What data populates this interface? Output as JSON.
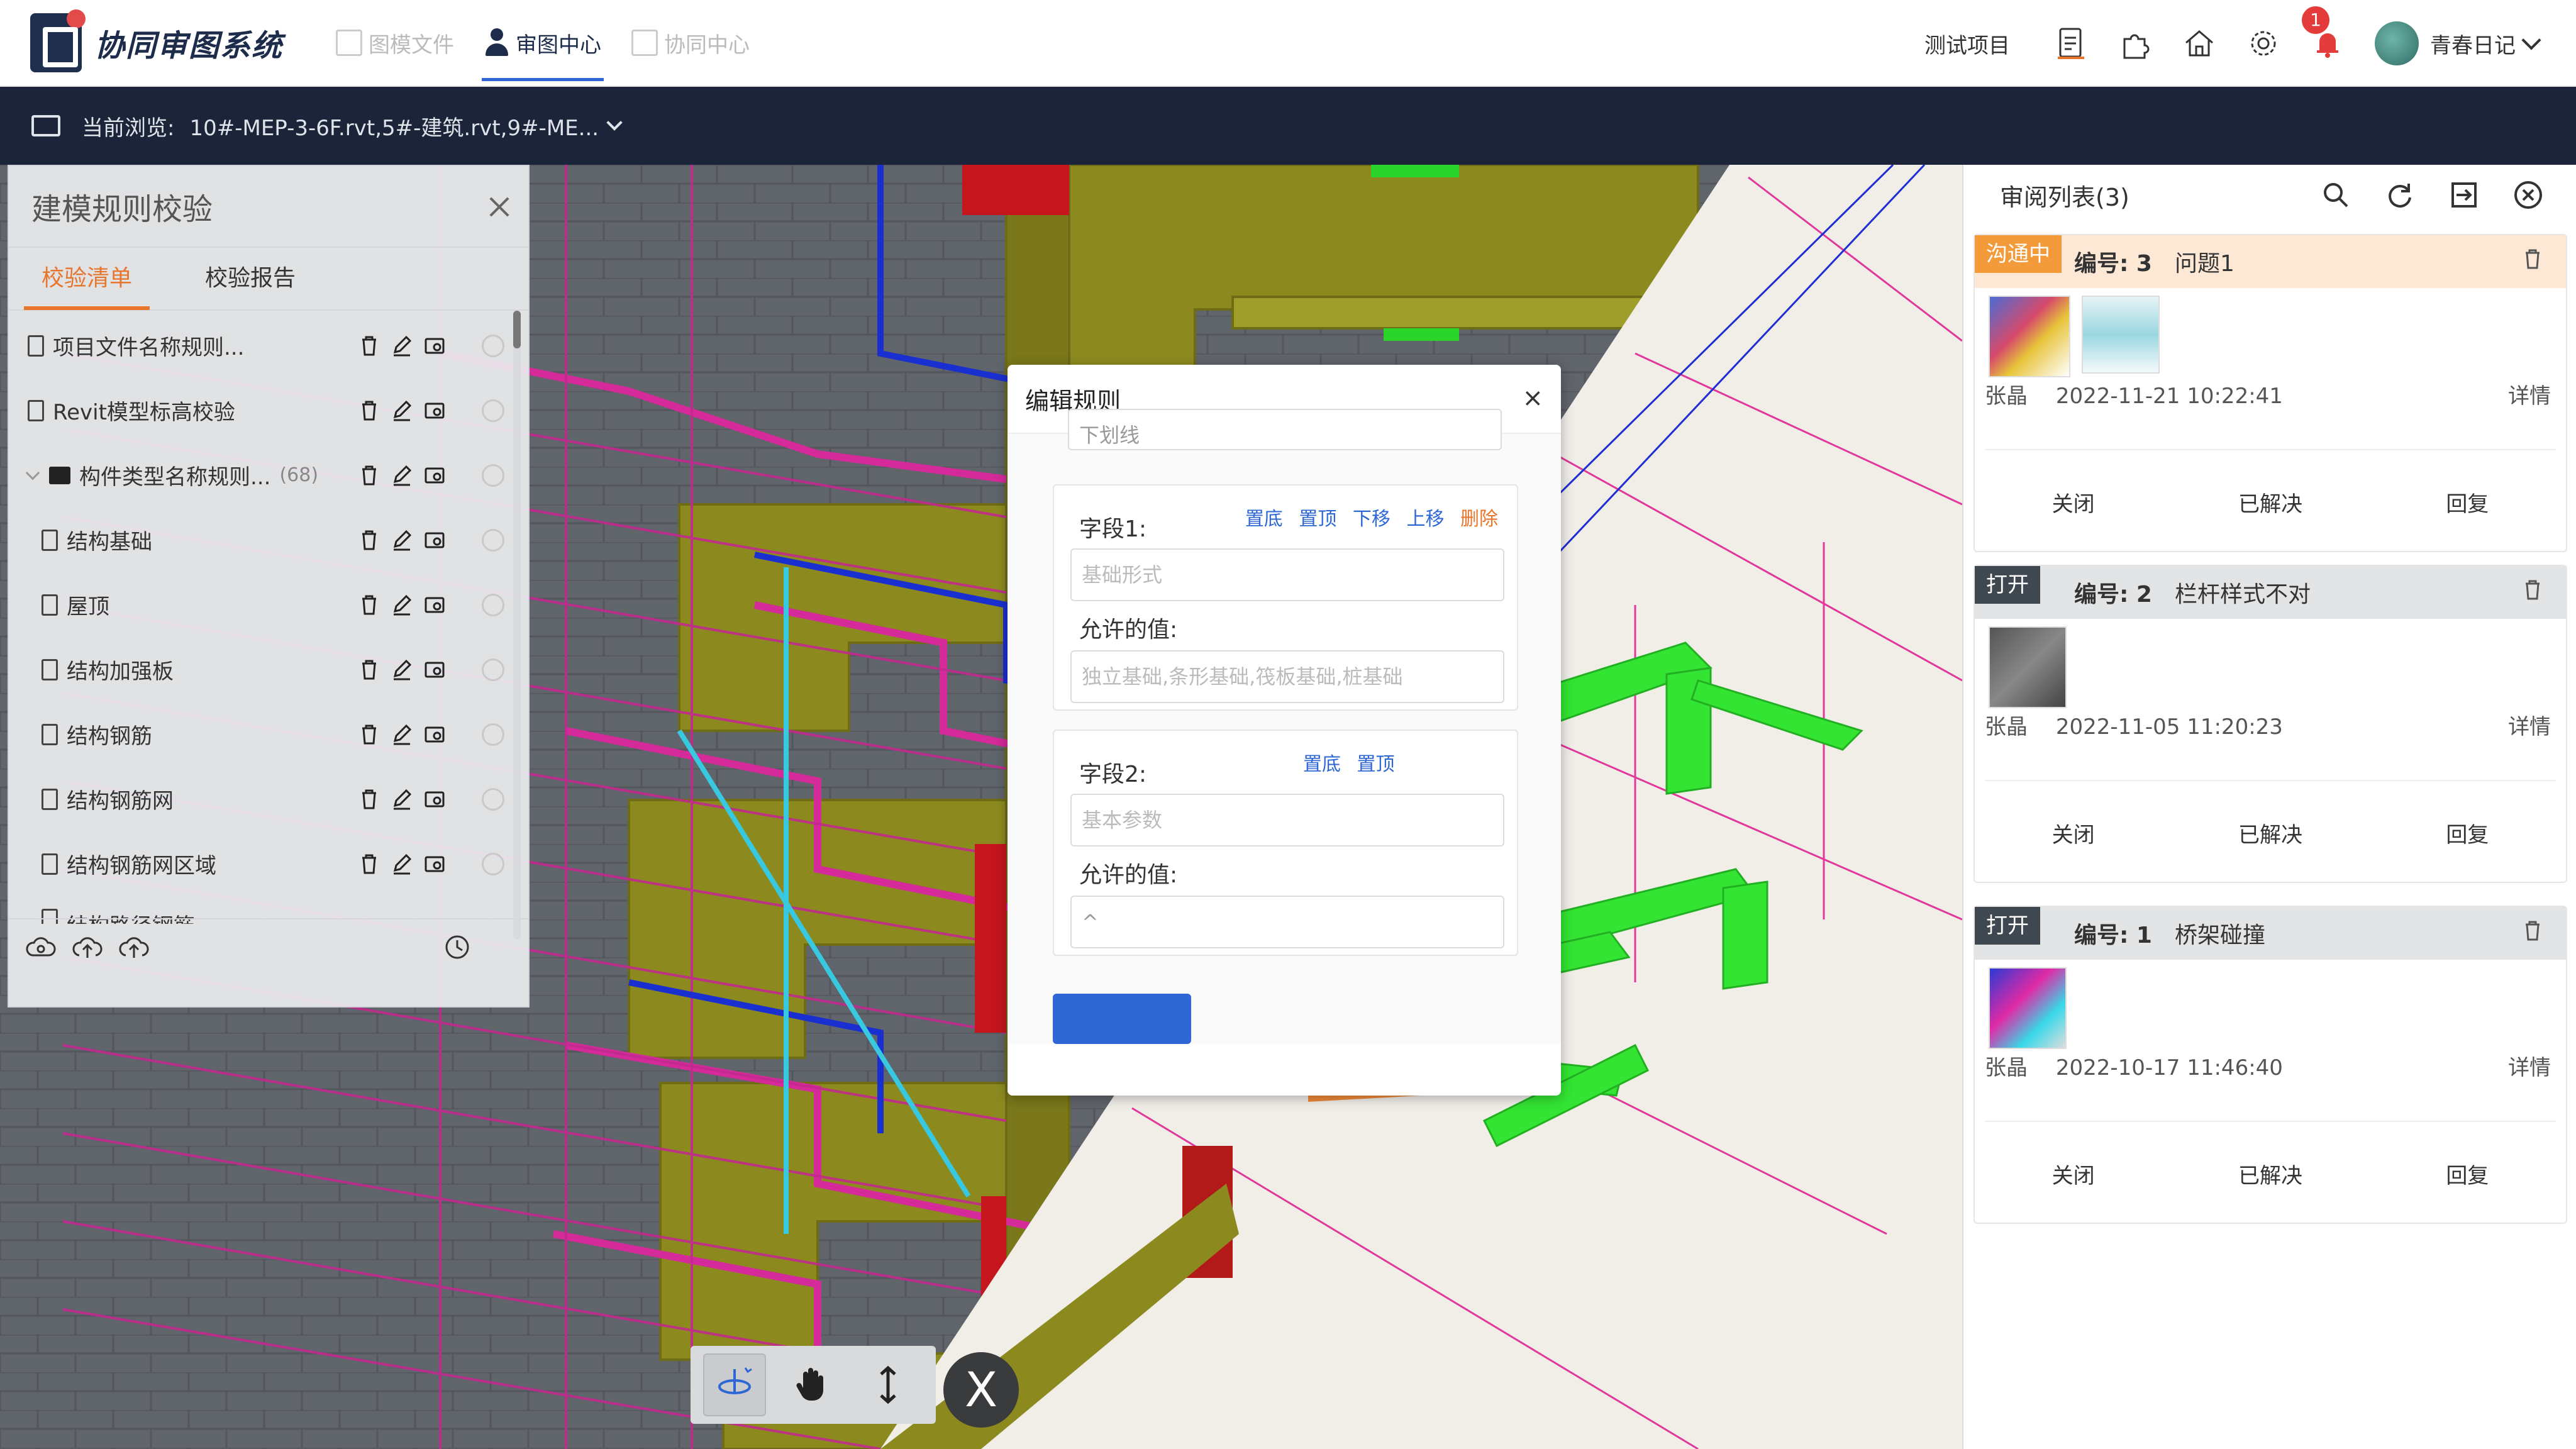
{
  "app": {
    "title": "协同审图系统",
    "tabs": [
      {
        "label": "图模文件",
        "active": false
      },
      {
        "label": "审图中心",
        "active": true
      },
      {
        "label": "协同中心",
        "active": false
      }
    ],
    "project": "测试项目",
    "notification_count": "1",
    "user": "青春日记",
    "icons": [
      "report-icon",
      "plugin-icon",
      "home-icon",
      "gear-icon",
      "bell-icon"
    ]
  },
  "breadcrumb": {
    "label": "当前浏览:",
    "files": "10#-MEP-3-6F.rvt,5#-建筑.rvt,9#-ME..."
  },
  "rules_panel": {
    "title": "建模规则校验",
    "tabs": [
      {
        "label": "校验清单",
        "active": true
      },
      {
        "label": "校验报告",
        "active": false
      }
    ],
    "items": [
      {
        "label": "项目文件名称规则...",
        "kind": "doc",
        "indent": 0
      },
      {
        "label": "Revit模型标高校验",
        "kind": "doc",
        "indent": 0
      },
      {
        "label": "构件类型名称规则...",
        "kind": "folder",
        "indent": 0,
        "count": "(68)"
      },
      {
        "label": "结构基础",
        "kind": "doc",
        "indent": 1
      },
      {
        "label": "屋顶",
        "kind": "doc",
        "indent": 1
      },
      {
        "label": "结构加强板",
        "kind": "doc",
        "indent": 1
      },
      {
        "label": "结构钢筋",
        "kind": "doc",
        "indent": 1
      },
      {
        "label": "结构钢筋网",
        "kind": "doc",
        "indent": 1
      },
      {
        "label": "结构钢筋网区域",
        "kind": "doc",
        "indent": 1
      },
      {
        "label": "结构路径钢筋",
        "kind": "doc",
        "indent": 1
      }
    ]
  },
  "edit_dialog": {
    "title": "编辑规则",
    "top_input": "下划线",
    "field1": {
      "label": "字段1:",
      "actions": [
        "置底",
        "置顶",
        "下移",
        "上移",
        "删除"
      ],
      "placeholder": "基础形式",
      "allowed_label": "允许的值:",
      "allowed_placeholder": "独立基础,条形基础,筏板基础,桩基础"
    },
    "field2": {
      "label": "字段2:",
      "actions": [
        "置底",
        "置顶"
      ],
      "placeholder": "基本参数",
      "allowed_label": "允许的值:",
      "allowed_value": "^"
    }
  },
  "review_panel": {
    "title": "审阅列表(3)",
    "issues": [
      {
        "status": "沟通中",
        "status_color": "#f39a3a",
        "number": "编号: 3",
        "title": "问题1",
        "author": "张晶",
        "time": "2022-11-21 10:22:41",
        "detail": "详情",
        "actions": [
          "关闭",
          "已解决",
          "回复"
        ]
      },
      {
        "status": "打开",
        "status_color": "#3f4750",
        "number": "编号: 2",
        "title": "栏杆样式不对",
        "author": "张晶",
        "time": "2022-11-05 11:20:23",
        "detail": "详情",
        "actions": [
          "关闭",
          "已解决",
          "回复"
        ]
      },
      {
        "status": "打开",
        "status_color": "#3f4750",
        "number": "编号: 1",
        "title": "桥架碰撞",
        "author": "张晶",
        "time": "2022-10-17 11:46:40",
        "detail": "详情",
        "actions": [
          "关闭",
          "已解决",
          "回复"
        ]
      }
    ]
  },
  "bottom_toolbar": {
    "tools": [
      "orbit-icon",
      "pan-hand-icon",
      "vertical-move-icon"
    ],
    "close_label": "X"
  },
  "colors": {
    "accent_orange": "#e8752c",
    "link_blue": "#2e67d4",
    "dark_bar": "#1c2439"
  }
}
